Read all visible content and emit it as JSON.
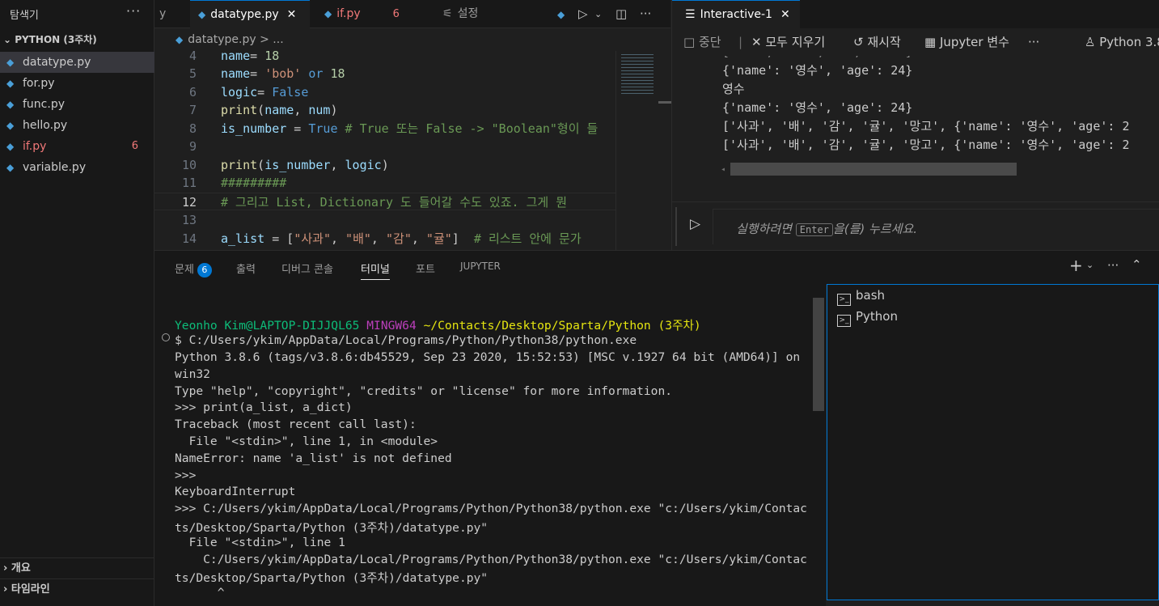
{
  "sidebar": {
    "title": "탐색기",
    "more": "···",
    "folder": "PYTHON (3주차)",
    "files": [
      {
        "name": "datatype.py",
        "count": ""
      },
      {
        "name": "for.py",
        "count": ""
      },
      {
        "name": "func.py",
        "count": ""
      },
      {
        "name": "hello.py",
        "count": ""
      },
      {
        "name": "if.py",
        "count": "6"
      },
      {
        "name": "variable.py",
        "count": ""
      }
    ],
    "outline": "개요",
    "timeline": "타임라인"
  },
  "editor": {
    "tabs": [
      {
        "label": "y"
      },
      {
        "label": "datatype.py",
        "close": "✕"
      },
      {
        "label": "if.py",
        "count": "6"
      },
      {
        "label": "설정"
      }
    ],
    "breadcrumb": "datatype.py > ...",
    "lines": [
      {
        "n": "4",
        "code": "name= 18"
      },
      {
        "n": "5",
        "code": "name= 'bob' or 18"
      },
      {
        "n": "6",
        "code": "logic= False"
      },
      {
        "n": "7",
        "code": "print(name, num)"
      },
      {
        "n": "8",
        "code": "is_number = True # True 또는 False -> \"Boolean\"형이 들"
      },
      {
        "n": "9",
        "code": ""
      },
      {
        "n": "10",
        "code": "print(is_number, logic)"
      },
      {
        "n": "11",
        "code": "#########"
      },
      {
        "n": "12",
        "code": "# 그리고 List, Dictionary 도 들어갈 수도 있죠. 그게 뭔"
      },
      {
        "n": "13",
        "code": ""
      },
      {
        "n": "14",
        "code": "a_list = [\"사과\", \"배\", \"감\", \"귤\"]  # 리스트 안에 문가"
      }
    ]
  },
  "interactive": {
    "tab": "Interactive-1",
    "tab_close": "✕",
    "toolbar": {
      "stop": "중단",
      "clear_all": "모두 지우기",
      "restart": "재시작",
      "variables": "Jupyter 변수",
      "more": "···",
      "kernel": "Python 3.8"
    },
    "output": [
      "{'name': '영수', 'age': 24}",
      "영수",
      "{'name': '영수', 'age': 24}",
      "['사과', '배', '감', '귤', '망고', {'name': '영수', 'age': 2",
      "['사과', '배', '감', '귤', '망고', {'name': '영수', 'age': 2"
    ],
    "input_placeholder_pre": "실행하려면",
    "input_key": "Enter",
    "input_placeholder_post": "을(를) 누르세요."
  },
  "panel": {
    "tabs": [
      "문제",
      "출력",
      "디버그 콘솔",
      "터미널",
      "포트",
      "JUPYTER"
    ],
    "problems_badge": "6",
    "add": "+",
    "more": "···"
  },
  "terminal": {
    "prompt_user": "Yeonho Kim@LAPTOP-DIJJQL65",
    "prompt_env": "MINGW64",
    "prompt_path": "~/Contacts/Desktop/Sparta/Python (3주차)",
    "lines": [
      "$ C:/Users/ykim/AppData/Local/Programs/Python/Python38/python.exe",
      "Python 3.8.6 (tags/v3.8.6:db45529, Sep 23 2020, 15:52:53) [MSC v.1927 64 bit (AMD64)] on",
      "win32",
      "Type \"help\", \"copyright\", \"credits\" or \"license\" for more information.",
      ">>> print(a_list, a_dict)",
      "Traceback (most recent call last):",
      "  File \"<stdin>\", line 1, in <module>",
      "NameError: name 'a_list' is not defined",
      ">>>",
      "KeyboardInterrupt",
      ">>> C:/Users/ykim/AppData/Local/Programs/Python/Python38/python.exe \"c:/Users/ykim/Contac",
      "ts/Desktop/Sparta/Python (3주차)/datatype.py\"",
      "  File \"<stdin>\", line 1",
      "    C:/Users/ykim/AppData/Local/Programs/Python/Python38/python.exe \"c:/Users/ykim/Contac",
      "ts/Desktop/Sparta/Python (3주차)/datatype.py\"",
      "      ^"
    ],
    "list": [
      "bash",
      "Python"
    ]
  },
  "colors": {
    "accent": "#0078d4",
    "error": "#f07878",
    "prompt_green": "#0dbc79",
    "prompt_magenta": "#bc3fbc",
    "prompt_yellow": "#e5e510"
  }
}
